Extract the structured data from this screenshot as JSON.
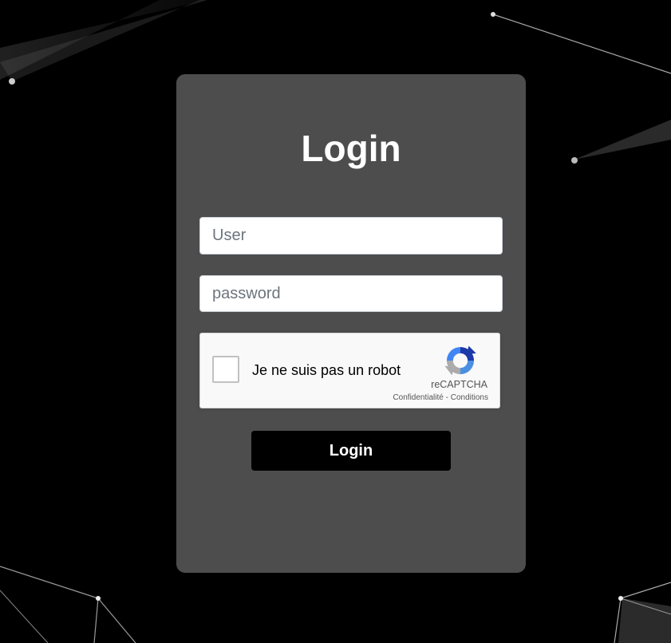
{
  "login_card": {
    "title": "Login",
    "user_placeholder": "User",
    "password_placeholder": "password",
    "submit_label": "Login"
  },
  "recaptcha": {
    "checkbox_label": "Je ne suis pas un robot",
    "brand": "reCAPTCHA",
    "privacy_link": "Confidentialité",
    "separator": "-",
    "terms_link": "Conditions"
  },
  "colors": {
    "page_background": "#000000",
    "card_background": "#4d4d4d",
    "button_background": "#000000",
    "title_text": "#ffffff"
  },
  "icons": [
    "recaptcha-logo-icon"
  ]
}
